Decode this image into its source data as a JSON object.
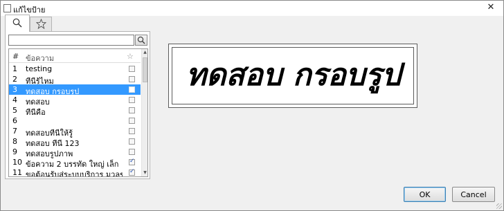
{
  "window": {
    "title": "แก้ไขป้าย"
  },
  "tabs": {
    "search_icon": "search-icon",
    "favorites_icon": "star-icon"
  },
  "search": {
    "value": "",
    "placeholder": ""
  },
  "list": {
    "headers": {
      "number": "#",
      "text": "ข้อความ",
      "favorite": "☆"
    },
    "rows": [
      {
        "num": "1",
        "text": "testing",
        "checked": false,
        "selected": false
      },
      {
        "num": "2",
        "text": "ทีนีรู้ไหม",
        "checked": false,
        "selected": false
      },
      {
        "num": "3",
        "text": "ทดสอบ กรอบรูป",
        "checked": false,
        "selected": true
      },
      {
        "num": "4",
        "text": "ทดสอบ",
        "checked": false,
        "selected": false
      },
      {
        "num": "5",
        "text": "ทีนีคือ",
        "checked": false,
        "selected": false
      },
      {
        "num": "6",
        "text": "",
        "checked": false,
        "selected": false
      },
      {
        "num": "7",
        "text": "ทดสอบทีนีให้รู้",
        "checked": false,
        "selected": false
      },
      {
        "num": "8",
        "text": "ทดสอบ ทีนี 123",
        "checked": false,
        "selected": false
      },
      {
        "num": "9",
        "text": "ทดสอบรูปภาพ",
        "checked": false,
        "selected": false
      },
      {
        "num": "10",
        "text": "ข้อความ 2 บรรทัด ใหญ่ เล็ก",
        "checked": true,
        "selected": false
      },
      {
        "num": "11",
        "text": "ขอต้อนรับสู่ระบบบริการ มวลชน",
        "checked": true,
        "selected": false
      }
    ]
  },
  "preview": {
    "text": "ทดสอบ กรอบรูป"
  },
  "buttons": {
    "ok": "OK",
    "cancel": "Cancel"
  }
}
